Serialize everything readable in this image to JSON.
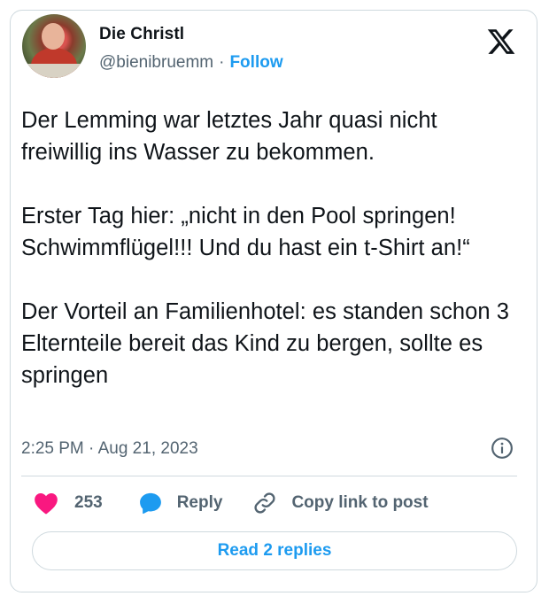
{
  "author": {
    "display_name": "Die Christl",
    "handle": "@bienibruemm",
    "separator": "·",
    "follow_label": "Follow"
  },
  "tweet": {
    "text": "Der Lemming war letztes Jahr quasi nicht freiwillig ins Wasser zu bekommen.\n\nErster Tag hier: „nicht in den Pool springen! Schwimmflügel!!! Und du hast ein t-Shirt an!“\n\nDer Vorteil an Familienhotel: es standen schon 3 Elternteile bereit das Kind zu bergen, sollte es springen",
    "timestamp": "2:25 PM · Aug 21, 2023"
  },
  "actions": {
    "like_count": "253",
    "reply_label": "Reply",
    "copy_link_label": "Copy link to post"
  },
  "read_replies_label": "Read 2 replies",
  "icons": {
    "brand": "x-logo-icon",
    "like": "heart-icon",
    "reply": "speech-bubble-icon",
    "copy": "link-icon",
    "info": "info-icon"
  },
  "colors": {
    "accent": "#1d9bf0",
    "like": "#f91880",
    "text": "#0f1419",
    "secondary_text": "#536471",
    "border": "#cfd9de"
  }
}
